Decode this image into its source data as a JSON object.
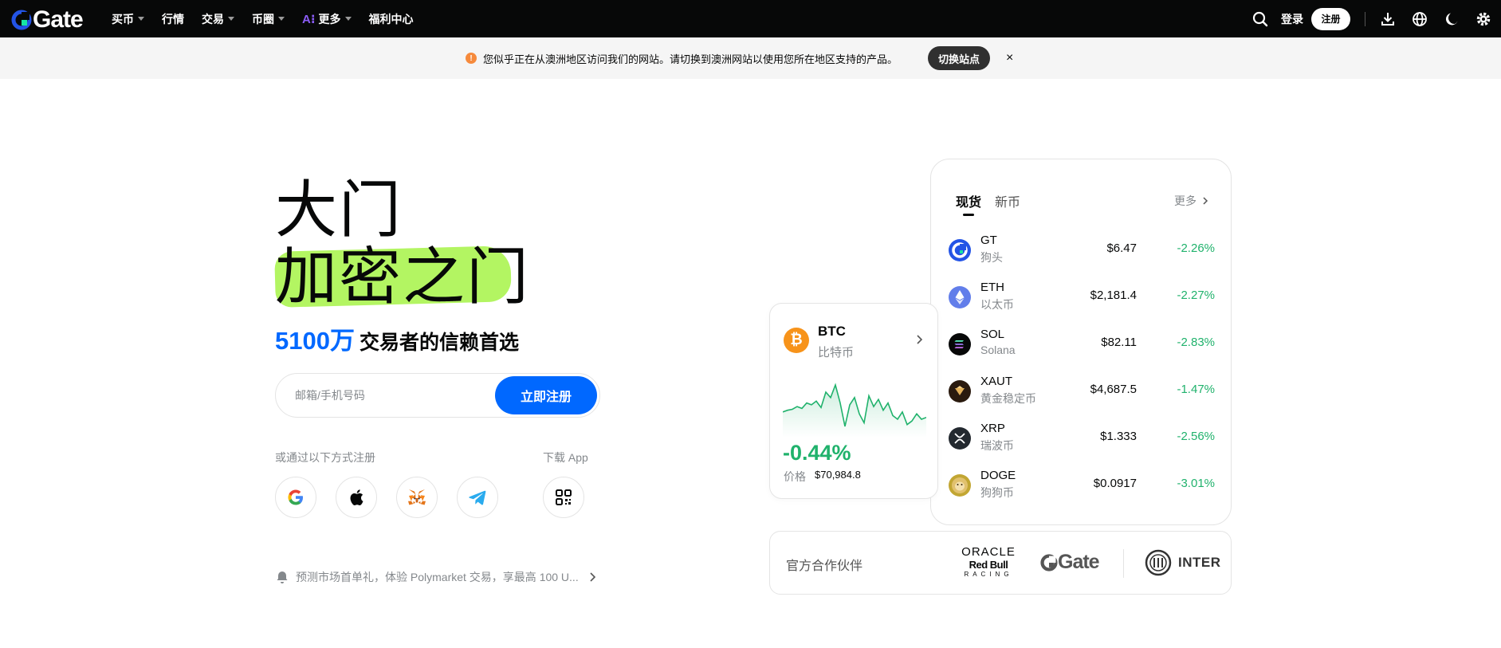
{
  "nav": {
    "logo_text": "Gate",
    "items": [
      {
        "label": "买币",
        "caret": true
      },
      {
        "label": "行情",
        "caret": false
      },
      {
        "label": "交易",
        "caret": true
      },
      {
        "label": "币圈",
        "caret": true
      },
      {
        "label": "更多",
        "caret": true,
        "ai": "A⁝"
      },
      {
        "label": "福利中心",
        "caret": false
      }
    ],
    "login": "登录",
    "signup": "注册"
  },
  "banner": {
    "text": "您似乎正在从澳洲地区访问我们的网站。请切换到澳洲网站以使用您所在地区支持的产品。",
    "switch_label": "切换站点",
    "close": "×"
  },
  "hero": {
    "line1": "大门",
    "line2": "加密之门",
    "count": "5100万",
    "subtitle": "交易者的信赖首选",
    "email_placeholder": "邮箱/手机号码",
    "register_label": "立即注册",
    "or_text": "或通过以下方式注册",
    "download_text": "下载 App",
    "notice": "预测市场首单礼，体验 Polymarket 交易，享最高 100 U..."
  },
  "market": {
    "tabs": [
      "现货",
      "新币"
    ],
    "more": "更多",
    "coins": [
      {
        "symbol": "GT",
        "name": "狗头",
        "price": "$6.47",
        "change": "-2.26%",
        "color": "#2354e6"
      },
      {
        "symbol": "ETH",
        "name": "以太币",
        "price": "$2,181.4",
        "change": "-2.27%",
        "color": "#627eea"
      },
      {
        "symbol": "SOL",
        "name": "Solana",
        "price": "$82.11",
        "change": "-2.83%",
        "color": "#070808"
      },
      {
        "symbol": "XAUT",
        "name": "黄金稳定币",
        "price": "$4,687.5",
        "change": "-1.47%",
        "color": "#2a1a0e"
      },
      {
        "symbol": "XRP",
        "name": "瑞波币",
        "price": "$1.333",
        "change": "-2.56%",
        "color": "#23292f"
      },
      {
        "symbol": "DOGE",
        "name": "狗狗币",
        "price": "$0.0917",
        "change": "-3.01%",
        "color": "#c2a633"
      }
    ]
  },
  "btc": {
    "symbol": "BTC",
    "name": "比特币",
    "change": "-0.44%",
    "price_label": "价格",
    "price": "$70,984.8",
    "spark": [
      30,
      28,
      27,
      24,
      26,
      20,
      22,
      18,
      25,
      8,
      14,
      0,
      20,
      46,
      22,
      14,
      32,
      42,
      12,
      24,
      16,
      28,
      20,
      34,
      38,
      30,
      44,
      40,
      32,
      38,
      36
    ]
  },
  "partners": {
    "label": "官方合作伙伴",
    "oracle_line1": "ORACLE",
    "oracle_line2": "Red Bull",
    "oracle_line3": "RACING",
    "gate": "Gate",
    "inter": "INTER"
  }
}
